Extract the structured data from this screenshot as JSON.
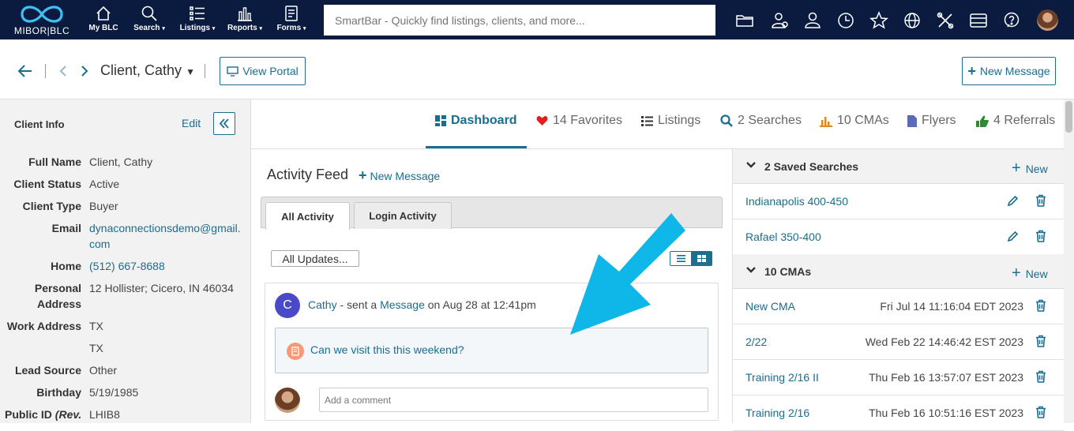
{
  "app": {
    "logo_text": "MIBOR|BLC",
    "colors": {
      "navbar": "#0b1b3f",
      "accent": "#1a6d8f",
      "favorite_heart": "#e02020",
      "arrow": "#0fb6e8"
    }
  },
  "nav": {
    "items": [
      {
        "label": "My BLC",
        "icon": "home-icon",
        "dropdown": false
      },
      {
        "label": "Search",
        "icon": "search-icon",
        "dropdown": true
      },
      {
        "label": "Listings",
        "icon": "list-icon",
        "dropdown": true
      },
      {
        "label": "Reports",
        "icon": "bar-chart-icon",
        "dropdown": true
      },
      {
        "label": "Forms",
        "icon": "document-icon",
        "dropdown": true
      }
    ],
    "dropdown_glyph": "▾",
    "smartbar_placeholder": "SmartBar - Quickly find listings, clients, and more...",
    "right_icons": [
      "folder-icon",
      "user-badge-icon",
      "user-icon",
      "clock-icon",
      "star-icon",
      "globe-icon",
      "tools-icon",
      "card-icon",
      "help-icon",
      "profile-avatar-icon"
    ]
  },
  "toolbar": {
    "client_name": "Client, Cathy",
    "view_portal": "View Portal",
    "new_message": "New Message"
  },
  "client_info": {
    "heading": "Client Info",
    "edit": "Edit",
    "fields": [
      {
        "label": "Full Name",
        "value": "Client, Cathy"
      },
      {
        "label": "Client Status",
        "value": "Active"
      },
      {
        "label": "Client Type",
        "value": "Buyer"
      },
      {
        "label": "Email",
        "value": "dynaconnectionsdemo@gmail.com"
      },
      {
        "label": "Home",
        "value": "(512) 667-8688"
      },
      {
        "label": "Personal Address",
        "value": "12 Hollister; Cicero, IN 46034"
      },
      {
        "label": "Work Address",
        "value": "TX"
      },
      {
        "label": "",
        "value": "TX"
      },
      {
        "label": "Lead Source",
        "value": "Other"
      },
      {
        "label": "Birthday",
        "value": "5/19/1985"
      },
      {
        "label": "Public ID",
        "label_suffix": "(Rev.",
        "value": "LHIB8"
      }
    ]
  },
  "tabs": [
    {
      "label": "Dashboard",
      "icon": "dashboard-icon",
      "active": true
    },
    {
      "label": "14 Favorites",
      "icon": "heart-icon",
      "active": false
    },
    {
      "label": "Listings",
      "icon": "list-icon",
      "active": false
    },
    {
      "label": "2 Searches",
      "icon": "search-icon",
      "active": false
    },
    {
      "label": "10 CMAs",
      "icon": "bar-chart-icon",
      "active": false
    },
    {
      "label": "Flyers",
      "icon": "file-icon",
      "active": false
    },
    {
      "label": "4 Referrals",
      "icon": "thumbs-up-icon",
      "active": false
    }
  ],
  "feed": {
    "title": "Activity Feed",
    "new_message": "New Message",
    "subtabs": [
      "All Activity",
      "Login Activity"
    ],
    "filter": "All Updates...",
    "item": {
      "avatar_letter": "C",
      "user": "Cathy",
      "action": "- sent a",
      "object": "Message",
      "when": "on Aug 28 at 12:41pm",
      "message": "Can we visit this this weekend?"
    },
    "comment_placeholder": "Add a comment"
  },
  "saved_searches": {
    "title": "2 Saved Searches",
    "new": "New",
    "items": [
      "Indianapolis 400-450",
      "Rafael 350-400"
    ]
  },
  "cmas": {
    "title": "10 CMAs",
    "new": "New",
    "items": [
      {
        "name": "New CMA",
        "date": "Fri Jul 14 11:16:04 EDT 2023"
      },
      {
        "name": "2/22",
        "date": "Wed Feb 22 14:46:42 EST 2023"
      },
      {
        "name": "Training 2/16 II",
        "date": "Thu Feb 16 13:57:07 EST 2023"
      },
      {
        "name": "Training 2/16",
        "date": "Thu Feb 16 10:51:16 EST 2023"
      }
    ]
  }
}
